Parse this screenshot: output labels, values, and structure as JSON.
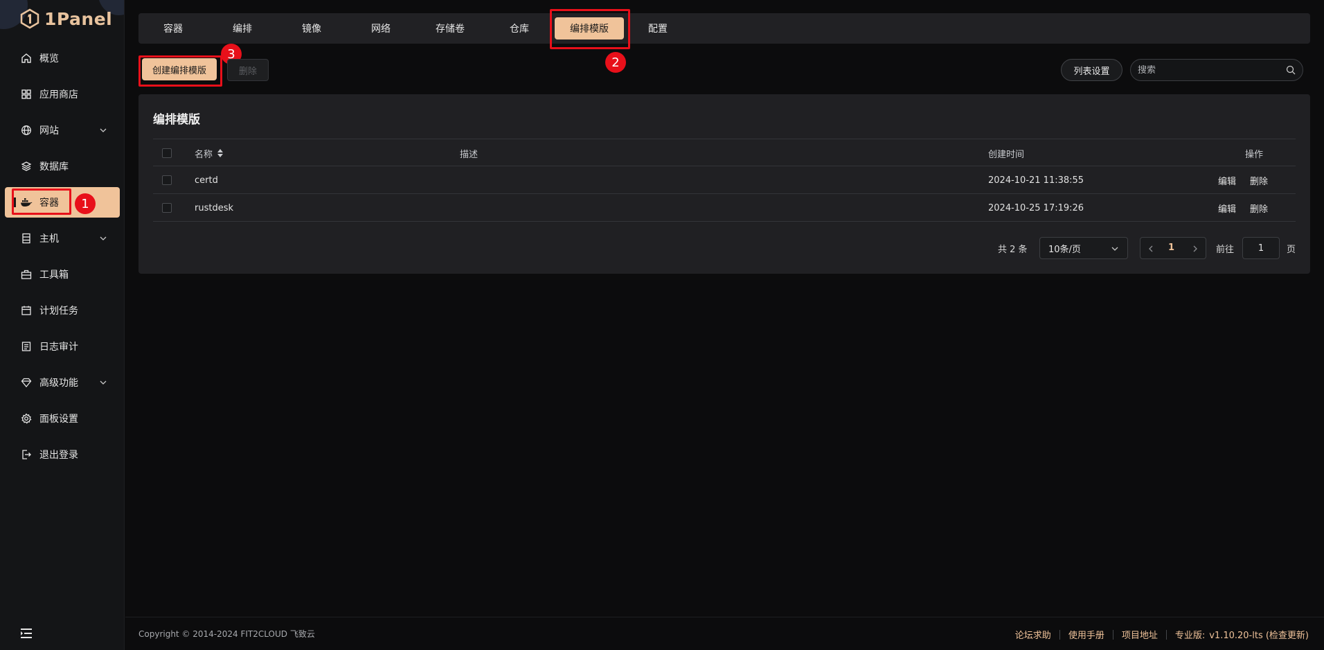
{
  "app": {
    "name": "1Panel"
  },
  "sidebar": {
    "items": [
      {
        "label": "概览",
        "icon": "home-icon"
      },
      {
        "label": "应用商店",
        "icon": "grid-icon"
      },
      {
        "label": "网站",
        "icon": "globe-icon",
        "expandable": true
      },
      {
        "label": "数据库",
        "icon": "layers-icon"
      },
      {
        "label": "容器",
        "icon": "docker-icon",
        "active": true
      },
      {
        "label": "主机",
        "icon": "server-icon",
        "expandable": true
      },
      {
        "label": "工具箱",
        "icon": "toolbox-icon"
      },
      {
        "label": "计划任务",
        "icon": "calendar-icon"
      },
      {
        "label": "日志审计",
        "icon": "log-icon"
      },
      {
        "label": "高级功能",
        "icon": "diamond-icon",
        "expandable": true
      },
      {
        "label": "面板设置",
        "icon": "gear-icon"
      },
      {
        "label": "退出登录",
        "icon": "logout-icon"
      }
    ]
  },
  "tabs": [
    {
      "label": "容器"
    },
    {
      "label": "编排"
    },
    {
      "label": "镜像"
    },
    {
      "label": "网络"
    },
    {
      "label": "存储卷"
    },
    {
      "label": "仓库"
    },
    {
      "label": "编排模版",
      "active": true
    },
    {
      "label": "配置"
    }
  ],
  "toolbar": {
    "create_label": "创建编排模版",
    "delete_label": "删除",
    "list_settings_label": "列表设置",
    "search_placeholder": "搜索"
  },
  "annotations": [
    "1",
    "2",
    "3"
  ],
  "card": {
    "title": "编排模版",
    "columns": {
      "name": "名称",
      "description": "描述",
      "created": "创建时间",
      "actions": "操作"
    },
    "rows": [
      {
        "name": "certd",
        "description": "",
        "created": "2024-10-21 11:38:55",
        "edit": "编辑",
        "delete": "删除"
      },
      {
        "name": "rustdesk",
        "description": "",
        "created": "2024-10-25 17:19:26",
        "edit": "编辑",
        "delete": "删除"
      }
    ]
  },
  "pagination": {
    "total_label": "共 2 条",
    "page_size": "10条/页",
    "current_page": "1",
    "goto_prefix": "前往",
    "goto_value": "1",
    "goto_suffix": "页"
  },
  "footer": {
    "copyright": "Copyright © 2014-2024 FIT2CLOUD 飞致云",
    "links": [
      "论坛求助",
      "使用手册",
      "项目地址"
    ],
    "edition_label": "专业版:",
    "version": "v1.10.20-lts (检查更新)"
  },
  "colors": {
    "accent": "#f0c39a",
    "highlight": "#e8101a",
    "background": "#0c0c0d",
    "panel": "#202023"
  }
}
